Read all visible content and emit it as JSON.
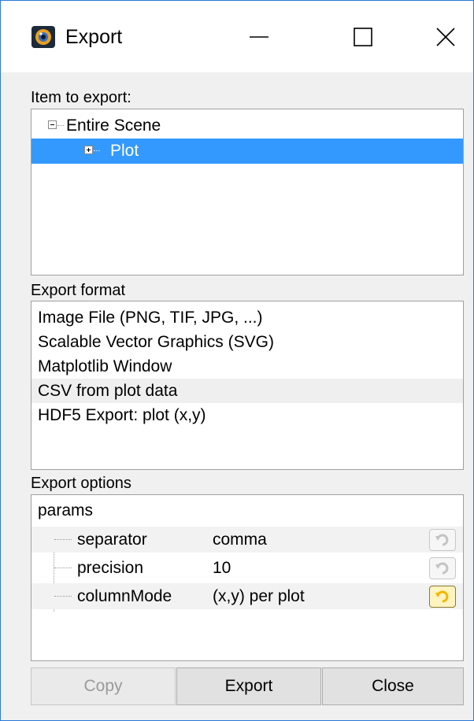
{
  "window": {
    "title": "Export",
    "app_icon": "camera-lens-icon",
    "controls": [
      "minimize-icon",
      "maximize-icon",
      "close-icon"
    ]
  },
  "item_tree": {
    "label": "Item to export:",
    "items": [
      {
        "label": "Entire Scene",
        "expander": "collapse",
        "selected": false
      },
      {
        "label": "Plot",
        "expander": "expand",
        "selected": true
      }
    ]
  },
  "export_format": {
    "label": "Export format",
    "items": [
      "Image File (PNG, TIF, JPG, ...)",
      "Scalable Vector Graphics (SVG)",
      "Matplotlib Window",
      "CSV from plot data",
      "HDF5 Export: plot (x,y)"
    ],
    "highlighted": "CSV from plot data"
  },
  "export_options": {
    "label": "Export options",
    "group": "params",
    "params": [
      {
        "name": "separator",
        "value": "comma",
        "reset_icon": "undo-icon",
        "modified": false
      },
      {
        "name": "precision",
        "value": "10",
        "reset_icon": "undo-icon",
        "modified": false
      },
      {
        "name": "columnMode",
        "value": "(x,y) per plot",
        "reset_icon": "undo-icon",
        "modified": true
      }
    ]
  },
  "buttons": {
    "copy": "Copy",
    "export": "Export",
    "close": "Close"
  },
  "colors": {
    "selection": "#3399ff",
    "window_border": "#2b79d8",
    "reset_active": "#f2b600"
  }
}
